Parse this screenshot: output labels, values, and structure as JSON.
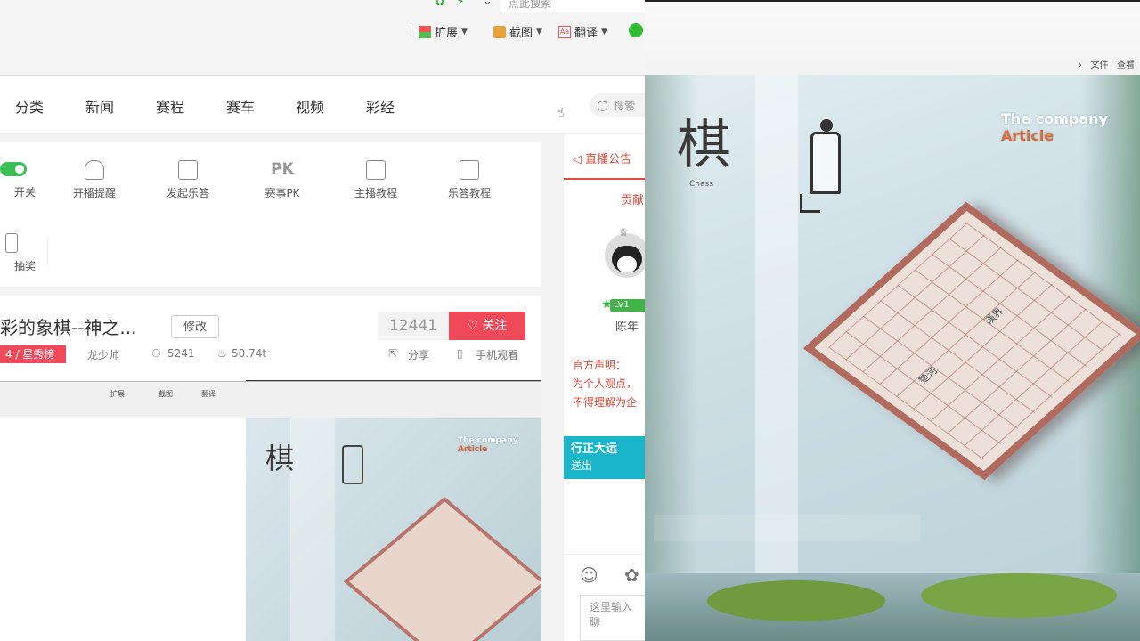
{
  "toolbar": {
    "search_placeholder": "点此搜索",
    "extend_label": "扩展",
    "screenshot_label": "截图",
    "translate_label": "翻译"
  },
  "nav": {
    "items": [
      "分类",
      "新闻",
      "赛程",
      "赛车",
      "视频",
      "彩经"
    ],
    "search_placeholder": "搜索"
  },
  "tools": {
    "row1": [
      "开关",
      "开播提醒",
      "发起乐答",
      "赛事PK",
      "主播教程",
      "乐答教程"
    ],
    "row2": [
      "抽奖"
    ],
    "pk_icon_text": "PK"
  },
  "room": {
    "title": "彩的象棋--神之...",
    "edit_label": "修改",
    "count": "12441",
    "follow_label": "关注",
    "badge": "4 / 星秀榜",
    "host": "龙少帅",
    "viewers": "5241",
    "heat": "50.74t",
    "share_label": "分享",
    "mobile_label": "手机观看"
  },
  "sidebar": {
    "tab_label": "直播公告",
    "contrib_label": "贡献",
    "level": "LV1",
    "username": "陈年",
    "notice_lines": [
      "官方声明：",
      "为个人观点，",
      "不得理解为企"
    ],
    "gift_title": "行正大运",
    "gift_sub": "送出",
    "input_placeholder": "这里输入聊"
  },
  "embed": {
    "extend_label": "扩展",
    "screenshot_label": "截图",
    "translate_label": "翻译"
  },
  "video": {
    "crumb_file": "文件",
    "crumb_view": "查看",
    "big_char": "棋",
    "big_char_sub": "Chess",
    "company_text": "The company ",
    "company_accent": "Article",
    "board_labels": [
      "楚河",
      "漢界"
    ]
  },
  "colors": {
    "accent_red": "#f04a5a",
    "notice_red": "#e04a3a",
    "gift_cyan": "#1ab5c9",
    "level_green": "#43b24a"
  }
}
